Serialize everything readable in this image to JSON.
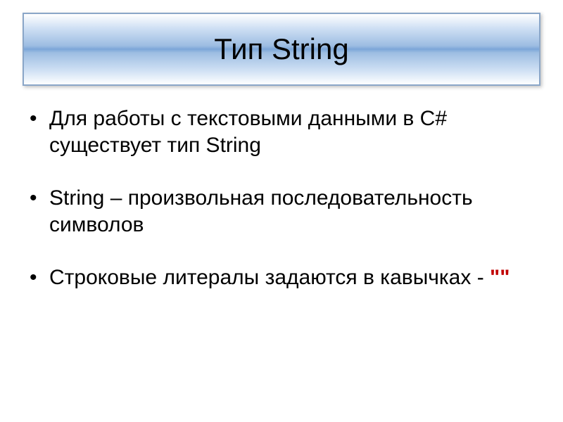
{
  "title": "Тип String",
  "bullets": [
    {
      "text": "Для работы с текстовыми данными в С# существует тип String"
    },
    {
      "text": "String – произвольная последовательность символов"
    },
    {
      "text": "Строковые литералы задаются в кавычках - ",
      "suffix": "\"\""
    }
  ]
}
